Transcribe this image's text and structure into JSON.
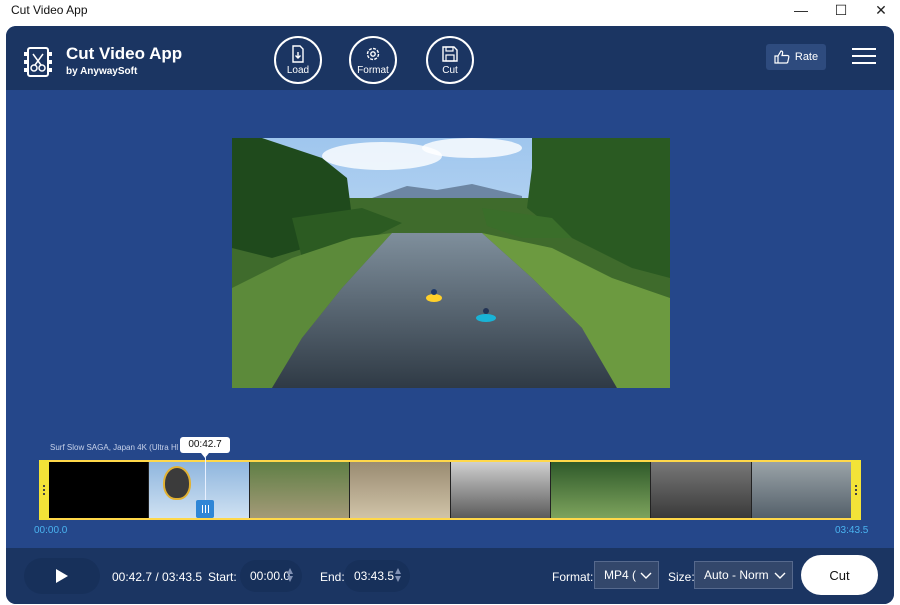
{
  "window": {
    "title": "Cut Video App",
    "controls": {
      "minimize": "—",
      "maximize": "☐",
      "close": "✕"
    }
  },
  "header": {
    "app_name": "Cut Video App",
    "subtitle": "by AnywaySoft",
    "load_label": "Load",
    "format_label": "Format",
    "cut_label": "Cut",
    "rate_label": "Rate"
  },
  "preview": {
    "description_icon": "video-frame"
  },
  "timeline": {
    "clip_name": "Surf Slow SAGA, Japan 4K (Ultra HD)",
    "playhead_time": "00:42.7",
    "playhead_fraction": 0.194,
    "start_time": "00:00.0",
    "end_time": "03:43.5",
    "frames": [
      "black",
      "balloon",
      "stream",
      "kids",
      "studio",
      "park",
      "machine",
      "river"
    ]
  },
  "bottom": {
    "current_time": "00:42.7 / 03:43.5",
    "start_label": "Start:",
    "start_value": "00:00.0",
    "end_label": "End:",
    "end_value": "03:43.5",
    "format_label": "Format:",
    "format_value": "MP4 (",
    "size_label": "Size:",
    "size_value": "Auto - Norm",
    "cut_button": "Cut"
  },
  "colors": {
    "background": "#25478a",
    "header": "#1b3562",
    "timeline_border": "#ffd84a",
    "time_accent": "#4ab3f0"
  }
}
